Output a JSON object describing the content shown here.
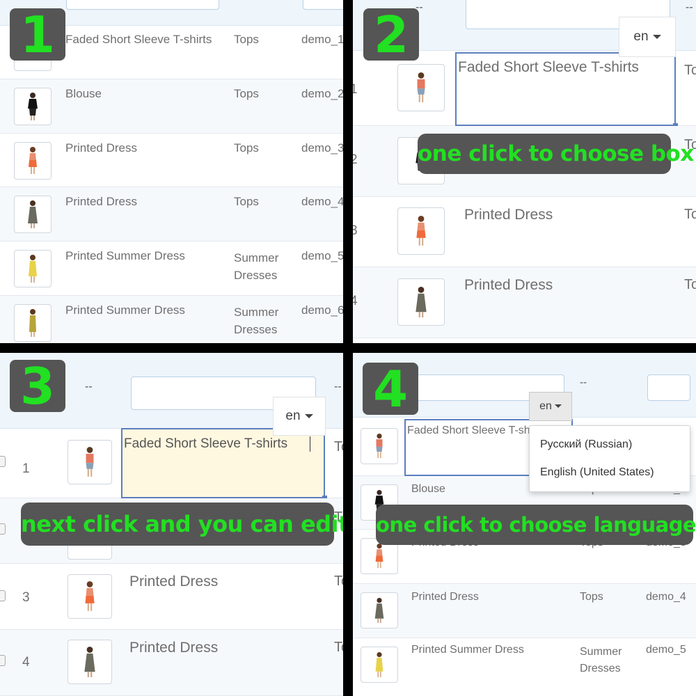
{
  "panels": {
    "p1": {
      "number": "1",
      "rows": [
        {
          "name": "Faded Short Sleeve T-shirts",
          "category": "Tops",
          "ref": "demo_1"
        },
        {
          "name": "Blouse",
          "category": "Tops",
          "ref": "demo_2"
        },
        {
          "name": "Printed Dress",
          "category": "Tops",
          "ref": "demo_3"
        },
        {
          "name": "Printed Dress",
          "category": "Tops",
          "ref": "demo_4"
        },
        {
          "name": "Printed Summer Dress",
          "category_l1": "Summer",
          "category_l2": "Dresses",
          "ref": "demo_5"
        },
        {
          "name": "Printed Summer Dress",
          "category_l1": "Summer",
          "category_l2": "Dresses",
          "ref": "demo_6"
        }
      ]
    },
    "p2": {
      "number": "2",
      "header_dash": "--",
      "lang_selected": "en",
      "edit_text": "Faded Short Sleeve T-shirts",
      "caption": "one click to choose box",
      "rows": [
        {
          "num": "1",
          "cat": "To"
        },
        {
          "num": "2",
          "cat": "To"
        },
        {
          "num": "3",
          "name": "Printed Dress",
          "cat": "To"
        },
        {
          "num": "4",
          "name": "Printed Dress",
          "cat": "To"
        }
      ]
    },
    "p3": {
      "number": "3",
      "header_dash": "--",
      "lang_selected": "en",
      "edit_text": "Faded Short Sleeve T-shirts",
      "caption": "next click and you can edit",
      "rows": [
        {
          "num": "1",
          "cat": "To"
        },
        {
          "num": "3",
          "name": "Printed Dress",
          "cat": "To"
        },
        {
          "num": "4",
          "name": "Printed Dress",
          "cat": "To"
        }
      ]
    },
    "p4": {
      "number": "4",
      "header_dash": "--",
      "lang_selected": "en",
      "edit_text": "Faded Short Sleeve T-shirts",
      "caption": "one click to choose language",
      "menu_options": [
        "Русский (Russian)",
        "English (United States)"
      ],
      "rows": [
        {
          "name": "Blouse",
          "category": "Tops",
          "ref": "demo_2"
        },
        {
          "name": "Printed Dress",
          "category": "Tops",
          "ref": "demo_3"
        },
        {
          "name": "Printed Dress",
          "category": "Tops",
          "ref": "demo_4"
        },
        {
          "name": "Printed Summer Dress",
          "category_l1": "Summer",
          "category_l2": "Dresses",
          "ref": "demo_5"
        }
      ]
    }
  },
  "colors": {
    "accent_green": "#22e022",
    "badge_bg": "#555555",
    "edit_border": "#5b7fbd",
    "edit_fill": "#fff8e1"
  }
}
